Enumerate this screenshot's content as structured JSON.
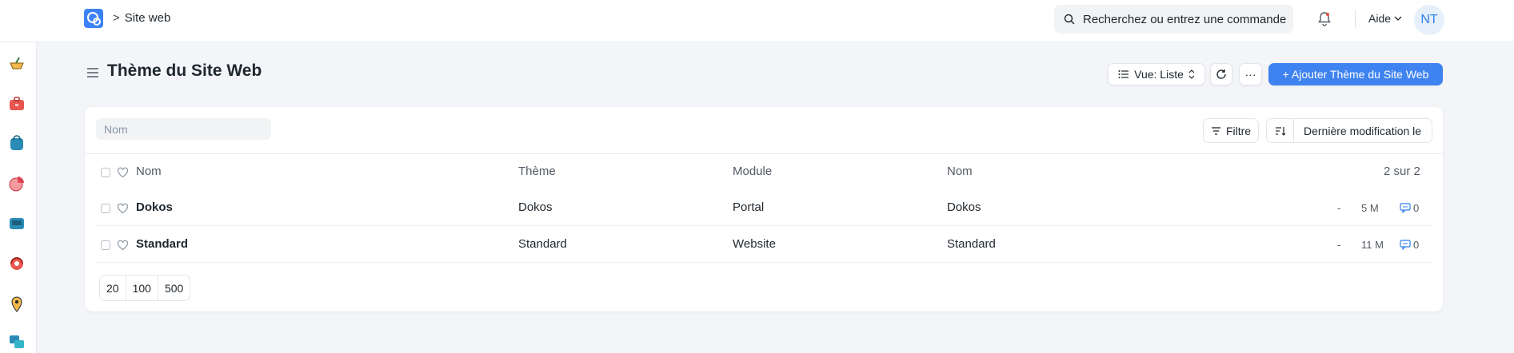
{
  "navbar": {
    "breadcrumb_sep": ">",
    "breadcrumb": "Site web",
    "search_label": "Recherchez ou entrez une commande",
    "help_label": "Aide",
    "avatar_initials": "NT"
  },
  "sidebar": {
    "icons": [
      "bowl-icon",
      "toolbox-icon",
      "bag-icon",
      "pie-chart-icon",
      "computer-icon",
      "support-icon",
      "location-pin-icon",
      "chat-icon"
    ]
  },
  "page": {
    "title": "Thème du Site Web",
    "view_label": "Vue: Liste",
    "more_label": "···",
    "add_button": "+ Ajouter Thème du Site Web"
  },
  "list": {
    "filter_placeholder": "Nom",
    "filter_button": "Filtre",
    "sort_label": "Dernière modification le",
    "columns": [
      "Nom",
      "Thème",
      "Module",
      "Nom"
    ],
    "count": "2 sur 2",
    "rows": [
      {
        "name": "Dokos",
        "theme": "Dokos",
        "module": "Portal",
        "name2": "Dokos",
        "dash": "-",
        "modified": "5 M",
        "comments": "0"
      },
      {
        "name": "Standard",
        "theme": "Standard",
        "module": "Website",
        "name2": "Standard",
        "dash": "-",
        "modified": "11 M",
        "comments": "0"
      }
    ],
    "page_sizes": [
      "20",
      "100",
      "500"
    ]
  },
  "colors": {
    "accent": "#3f83f0",
    "background": "#f3f5f8"
  }
}
